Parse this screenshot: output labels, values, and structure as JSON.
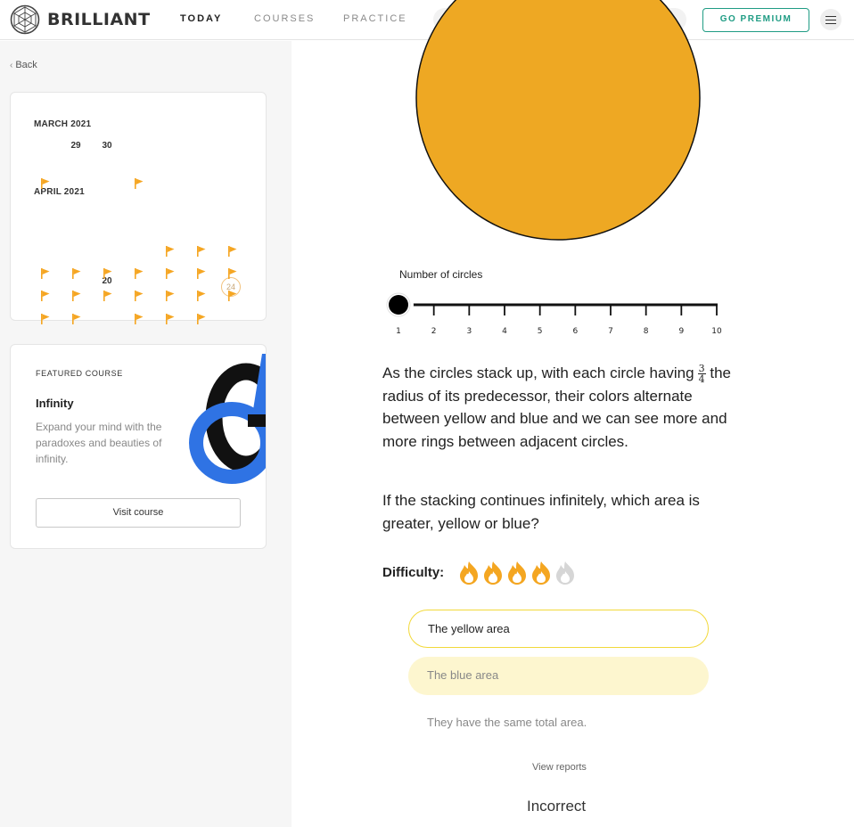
{
  "header": {
    "brand": "BRILLIANT",
    "nav": [
      {
        "label": "TODAY",
        "active": true
      },
      {
        "label": "COURSES",
        "active": false
      },
      {
        "label": "PRACTICE",
        "active": false
      }
    ],
    "search_placeholder": "",
    "premium_label": "GO PREMIUM",
    "accent_color": "#1f9c84"
  },
  "sidebar": {
    "back_label": "Back",
    "calendar": {
      "months": [
        {
          "label": "MARCH 2021",
          "days": [
            "29",
            "30"
          ]
        },
        {
          "label": "APRIL 2021",
          "days": [
            "20"
          ],
          "today": "24"
        }
      ],
      "flag_color": "#f5a623"
    },
    "featured": {
      "label": "FEATURED  COURSE",
      "title": "Infinity",
      "description": "Expand your mind with the paradoxes and beauties of infinity.",
      "button_label": "Visit course"
    }
  },
  "main": {
    "circle_color": "#eea823",
    "slider": {
      "label": "Number of circles",
      "ticks": [
        "1",
        "2",
        "3",
        "4",
        "5",
        "6",
        "7",
        "8",
        "9",
        "10"
      ],
      "value": 1
    },
    "question": {
      "part1": "As the circles stack up, with each circle having",
      "fraction_num": "3",
      "fraction_den": "4",
      "part2": "the radius of its predecessor, their colors alternate between yellow and blue and we can see more and more rings between adjacent circles.",
      "follow_up": "If the stacking continues infinitely, which area is greater, yellow or blue?"
    },
    "difficulty": {
      "label": "Difficulty:",
      "level": 4,
      "max": 5
    },
    "choices": [
      {
        "label": "The yellow area"
      },
      {
        "label": "The blue area"
      },
      {
        "label": "They have the same total area."
      }
    ],
    "view_reports_label": "View reports",
    "result_label": "Incorrect"
  }
}
